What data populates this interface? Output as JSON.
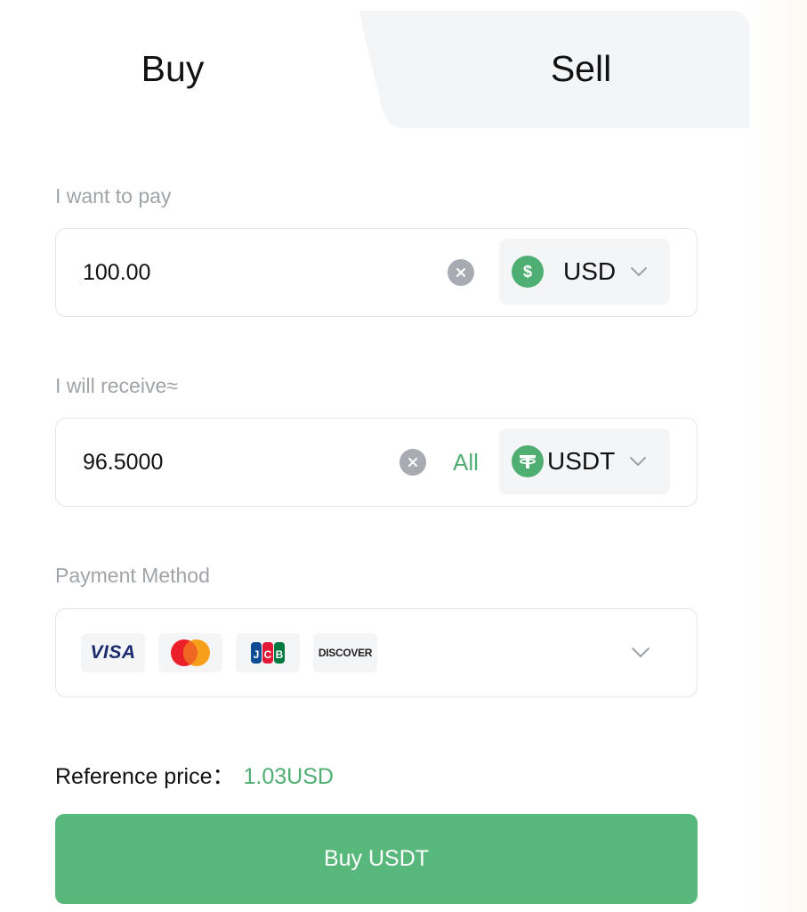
{
  "tabs": {
    "buy": "Buy",
    "sell": "Sell",
    "active": "Buy"
  },
  "pay": {
    "label": "I want to pay",
    "value": "100.00",
    "currency": "USD",
    "currency_icon": "dollar-coin-icon"
  },
  "receive": {
    "label": "I will receive≈",
    "value": "96.5000",
    "all_label": "All",
    "currency": "USDT",
    "currency_icon": "tether-icon"
  },
  "payment": {
    "label": "Payment Method",
    "methods": [
      "VISA",
      "mastercard",
      "JCB",
      "DISCOVER"
    ]
  },
  "reference": {
    "label": "Reference price：",
    "value": "1.03USD"
  },
  "submit_label": "Buy USDT",
  "colors": {
    "accent": "#4fae72",
    "button": "#58b77a",
    "muted": "#a0a3a8",
    "tab_inactive_bg": "#f4f5f7"
  }
}
